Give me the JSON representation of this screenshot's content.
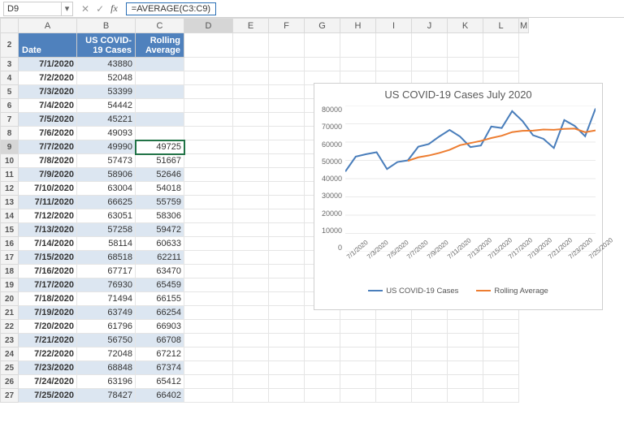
{
  "name_box": "D9",
  "formula": "=AVERAGE(C3:C9)",
  "col_letters": [
    "A",
    "B",
    "C",
    "D",
    "E",
    "F",
    "G",
    "H",
    "I",
    "J",
    "K",
    "L",
    "M"
  ],
  "headers": {
    "date": "Date",
    "cases": "US COVID-19 Cases",
    "avg": "Rolling Average"
  },
  "rows": [
    {
      "n": 3,
      "date": "7/1/2020",
      "cases": 43880,
      "avg": ""
    },
    {
      "n": 4,
      "date": "7/2/2020",
      "cases": 52048,
      "avg": ""
    },
    {
      "n": 5,
      "date": "7/3/2020",
      "cases": 53399,
      "avg": ""
    },
    {
      "n": 6,
      "date": "7/4/2020",
      "cases": 54442,
      "avg": ""
    },
    {
      "n": 7,
      "date": "7/5/2020",
      "cases": 45221,
      "avg": ""
    },
    {
      "n": 8,
      "date": "7/6/2020",
      "cases": 49093,
      "avg": ""
    },
    {
      "n": 9,
      "date": "7/7/2020",
      "cases": 49990,
      "avg": 49725
    },
    {
      "n": 10,
      "date": "7/8/2020",
      "cases": 57473,
      "avg": 51667
    },
    {
      "n": 11,
      "date": "7/9/2020",
      "cases": 58906,
      "avg": 52646
    },
    {
      "n": 12,
      "date": "7/10/2020",
      "cases": 63004,
      "avg": 54018
    },
    {
      "n": 13,
      "date": "7/11/2020",
      "cases": 66625,
      "avg": 55759
    },
    {
      "n": 14,
      "date": "7/12/2020",
      "cases": 63051,
      "avg": 58306
    },
    {
      "n": 15,
      "date": "7/13/2020",
      "cases": 57258,
      "avg": 59472
    },
    {
      "n": 16,
      "date": "7/14/2020",
      "cases": 58114,
      "avg": 60633
    },
    {
      "n": 17,
      "date": "7/15/2020",
      "cases": 68518,
      "avg": 62211
    },
    {
      "n": 18,
      "date": "7/16/2020",
      "cases": 67717,
      "avg": 63470
    },
    {
      "n": 19,
      "date": "7/17/2020",
      "cases": 76930,
      "avg": 65459
    },
    {
      "n": 20,
      "date": "7/18/2020",
      "cases": 71494,
      "avg": 66155
    },
    {
      "n": 21,
      "date": "7/19/2020",
      "cases": 63749,
      "avg": 66254
    },
    {
      "n": 22,
      "date": "7/20/2020",
      "cases": 61796,
      "avg": 66903
    },
    {
      "n": 23,
      "date": "7/21/2020",
      "cases": 56750,
      "avg": 66708
    },
    {
      "n": 24,
      "date": "7/22/2020",
      "cases": 72048,
      "avg": 67212
    },
    {
      "n": 25,
      "date": "7/23/2020",
      "cases": 68848,
      "avg": 67374
    },
    {
      "n": 26,
      "date": "7/24/2020",
      "cases": 63196,
      "avg": 65412
    },
    {
      "n": 27,
      "date": "7/25/2020",
      "cases": 78427,
      "avg": 66402
    }
  ],
  "selected_row": 9,
  "selected_col": "D",
  "chart_data": {
    "type": "line",
    "title": "US COVID-19 Cases July 2020",
    "xlabel": "",
    "ylabel": "",
    "ylim": [
      0,
      80000
    ],
    "y_ticks": [
      0,
      10000,
      20000,
      30000,
      40000,
      50000,
      60000,
      70000,
      80000
    ],
    "categories": [
      "7/1/2020",
      "7/2/2020",
      "7/3/2020",
      "7/4/2020",
      "7/5/2020",
      "7/6/2020",
      "7/7/2020",
      "7/8/2020",
      "7/9/2020",
      "7/10/2020",
      "7/11/2020",
      "7/12/2020",
      "7/13/2020",
      "7/14/2020",
      "7/15/2020",
      "7/16/2020",
      "7/17/2020",
      "7/18/2020",
      "7/19/2020",
      "7/20/2020",
      "7/21/2020",
      "7/22/2020",
      "7/23/2020",
      "7/24/2020",
      "7/25/2020"
    ],
    "x_tick_labels": [
      "7/1/2020",
      "7/3/2020",
      "7/5/2020",
      "7/7/2020",
      "7/9/2020",
      "7/11/2020",
      "7/13/2020",
      "7/15/2020",
      "7/17/2020",
      "7/19/2020",
      "7/21/2020",
      "7/23/2020",
      "7/25/2020"
    ],
    "series": [
      {
        "name": "US COVID-19 Cases",
        "color": "#4a7ebb",
        "values": [
          43880,
          52048,
          53399,
          54442,
          45221,
          49093,
          49990,
          57473,
          58906,
          63004,
          66625,
          63051,
          57258,
          58114,
          68518,
          67717,
          76930,
          71494,
          63749,
          61796,
          56750,
          72048,
          68848,
          63196,
          78427
        ]
      },
      {
        "name": "Rolling Average",
        "color": "#ed7d31",
        "values": [
          null,
          null,
          null,
          null,
          null,
          null,
          49725,
          51667,
          52646,
          54018,
          55759,
          58306,
          59472,
          60633,
          62211,
          63470,
          65459,
          66155,
          66254,
          66903,
          66708,
          67212,
          67374,
          65412,
          66402
        ]
      }
    ],
    "legend": [
      "US COVID-19 Cases",
      "Rolling Average"
    ]
  }
}
